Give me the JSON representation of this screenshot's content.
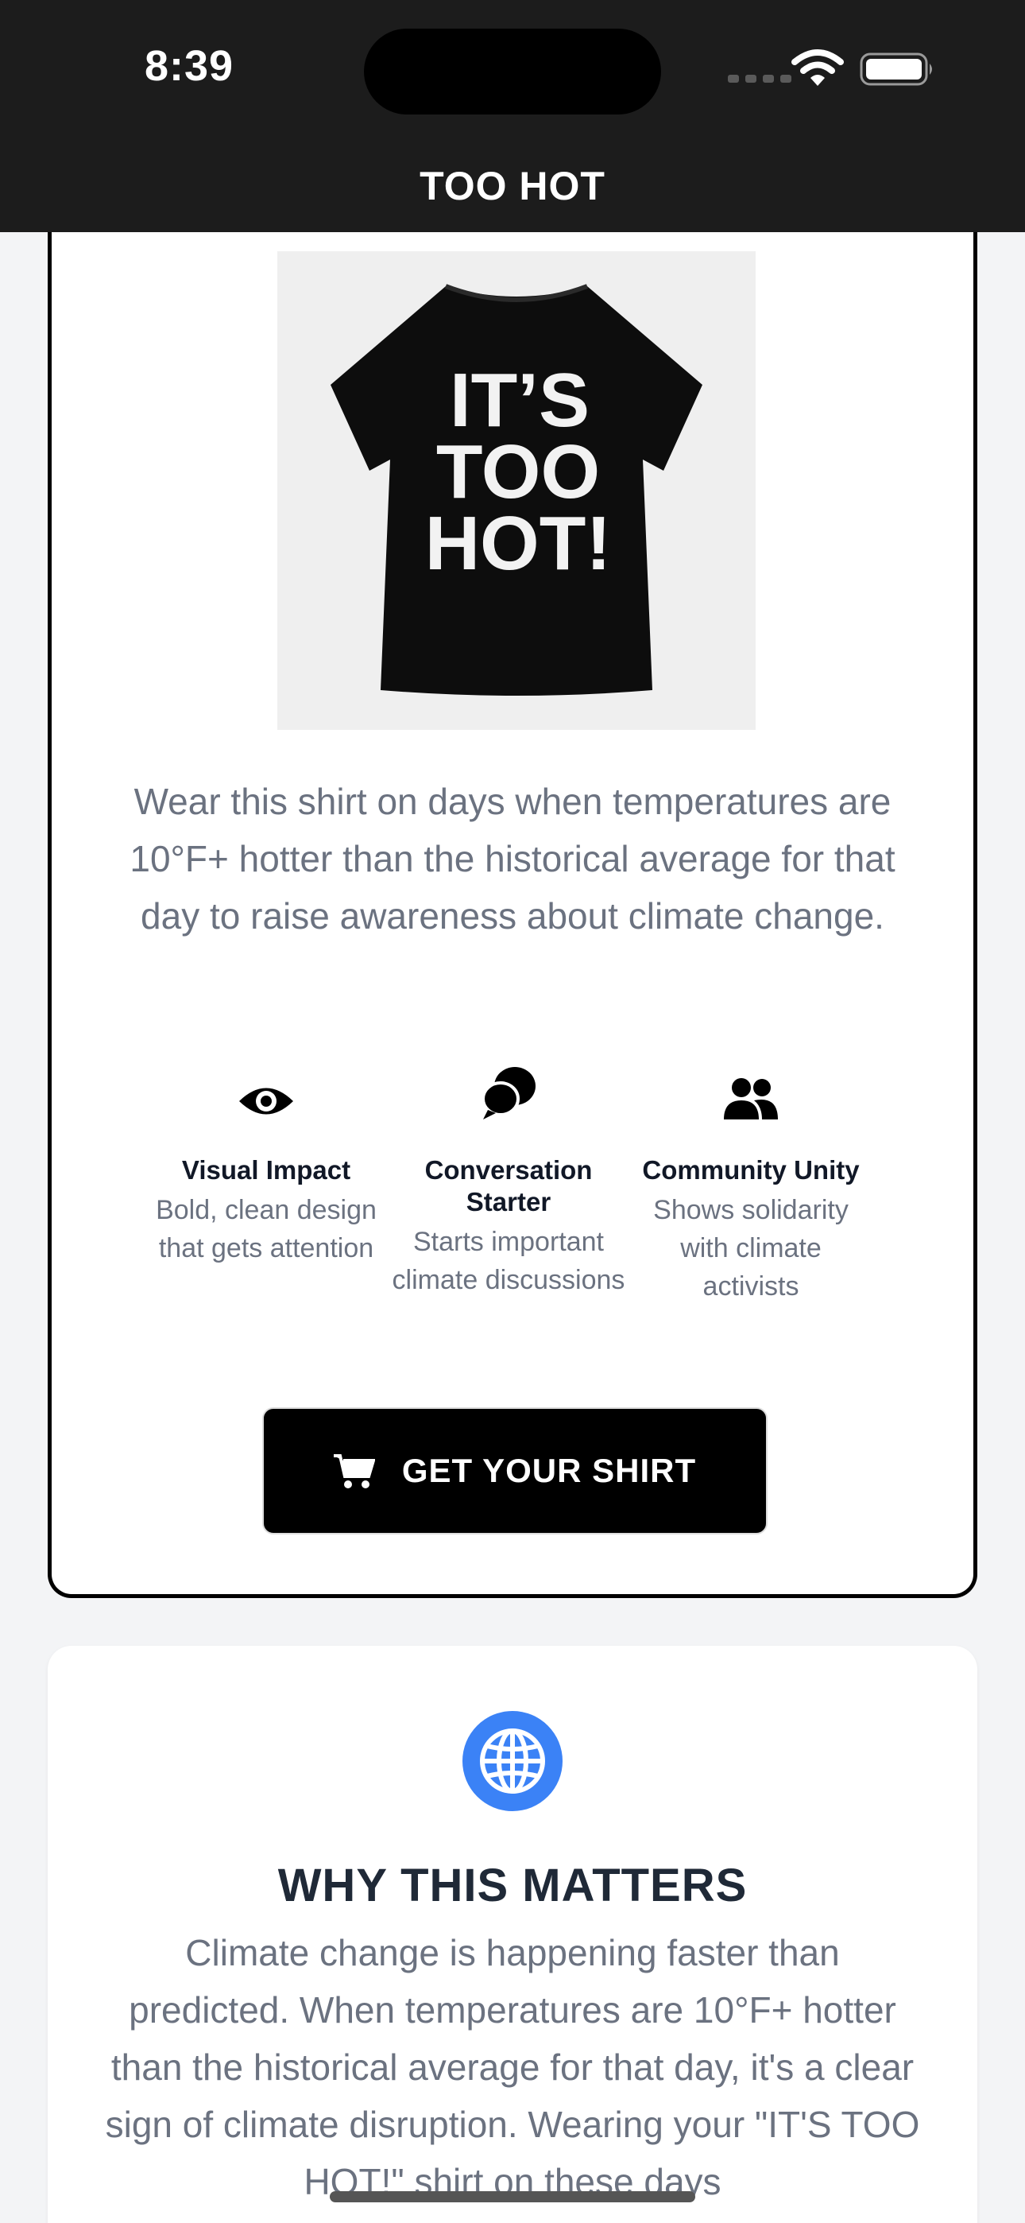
{
  "status_bar": {
    "time": "8:39"
  },
  "header": {
    "title": "TOO HOT"
  },
  "product": {
    "shirt_text": [
      "IT’S",
      "TOO",
      "HOT!"
    ],
    "description": "Wear this shirt on days when temperatures are 10°F+ hotter than the historical average for that day to raise awareness about climate change.",
    "features": [
      {
        "icon": "eye-icon",
        "title": "Visual Impact",
        "description": "Bold, clean design that gets attention"
      },
      {
        "icon": "chat-bubbles-icon",
        "title": "Conversation Starter",
        "description": "Starts important climate discussions"
      },
      {
        "icon": "users-icon",
        "title": "Community Unity",
        "description": "Shows solidarity with climate activists"
      }
    ],
    "buy_label": "GET YOUR SHIRT"
  },
  "why": {
    "icon": "globe-icon",
    "title": "WHY THIS MATTERS",
    "text": "Climate change is happening faster than predicted. When temperatures are 10°F+ hotter than the historical average for that day, it's a clear sign of climate disruption. Wearing your \"IT'S TOO HOT!\" shirt on these days"
  },
  "colors": {
    "accent_blue": "#3b82f6",
    "header_bg": "#1c1c1c"
  }
}
